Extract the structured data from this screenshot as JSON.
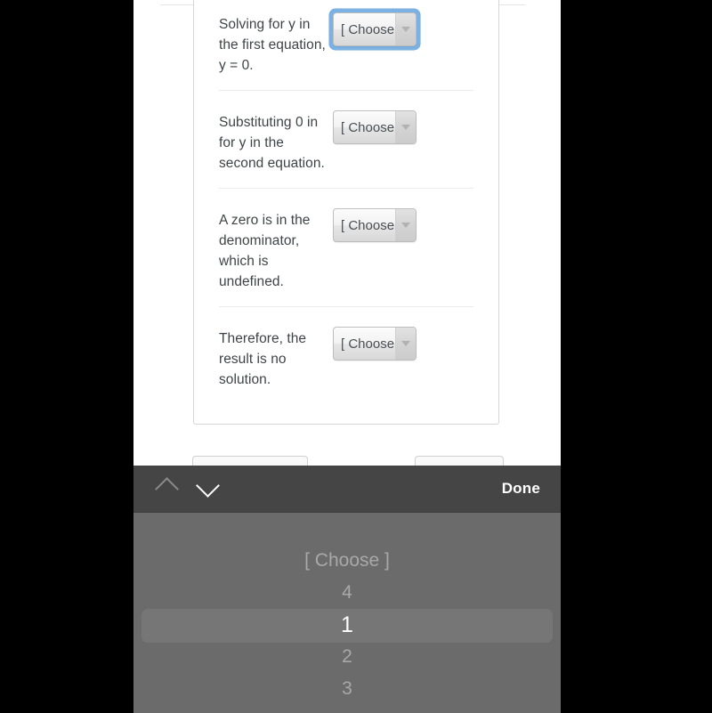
{
  "colors": {
    "letterbox": "#000000",
    "page_background": "#ffffff",
    "card_border": "#d6d6d6",
    "row_divider": "#ececec",
    "text": "#3f4447",
    "focus_ring": "#7cb1e4",
    "toolbar_background": "#454545",
    "picker_background": "#6b6b6b",
    "picker_selected_text": "#ffffff",
    "picker_item_text": "#a8a8a8"
  },
  "card": {
    "rows": [
      {
        "prompt": "Solving for y in the first equation, y = 0.",
        "select_value": "[ Choose",
        "focused": true
      },
      {
        "prompt": "Substituting 0 in for y in the second equation.",
        "select_value": "[ Choose",
        "focused": false
      },
      {
        "prompt": "A zero is in the denominator, which is undefined.",
        "select_value": "[ Choose",
        "focused": false
      },
      {
        "prompt": "Therefore, the result is no solution.",
        "select_value": "[ Choose",
        "focused": false
      }
    ]
  },
  "picker_toolbar": {
    "previous_icon": "chevron-up-icon",
    "next_icon": "chevron-down-icon",
    "done_label": "Done"
  },
  "picker": {
    "options": [
      {
        "label": "[ Choose ]",
        "selected": false
      },
      {
        "label": "4",
        "selected": false
      },
      {
        "label": "1",
        "selected": true
      },
      {
        "label": "2",
        "selected": false
      },
      {
        "label": "3",
        "selected": false
      }
    ],
    "selected_value": "1"
  }
}
